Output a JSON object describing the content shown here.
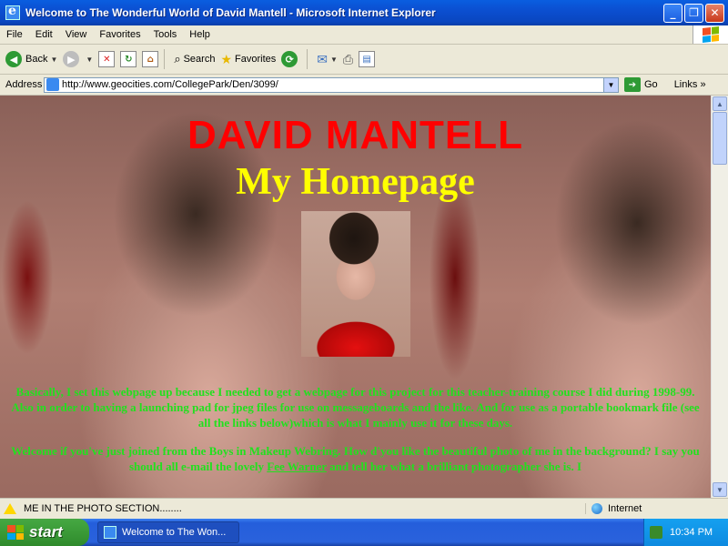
{
  "window": {
    "title": "Welcome to The Wonderful World of David Mantell - Microsoft Internet Explorer",
    "buttons": {
      "minimize": "_",
      "maximize": "❐",
      "close": "✕"
    }
  },
  "menu": [
    "File",
    "Edit",
    "View",
    "Favorites",
    "Tools",
    "Help"
  ],
  "toolbar": {
    "back": "Back",
    "search": "Search",
    "favorites": "Favorites"
  },
  "address": {
    "label": "Address",
    "url": "http://www.geocities.com/CollegePark/Den/3099/",
    "go": "Go",
    "links": "Links"
  },
  "page": {
    "name": "DAVID MANTELL",
    "subtitle": "My Homepage",
    "para1": "Basically, I set this webpage up because I needed to get a webpage for this project for this teacher-training course I did during 1998-99. Also in order to having a launching pad for jpeg files for use on messageboards and the like. And for use as a portable bookmark file (see all the links below)which is what I mainly use it for these days.",
    "para2_a": "Welcome if you've just joined from the Boys in Makeup Webring. How d'you like the beautiful photo of me in the background? I say you should all e-mail the lovely ",
    "para2_link": "Fee Warner",
    "para2_b": " and tell her what a brilliant photographer she is. I"
  },
  "status": {
    "text": "ME IN THE PHOTO SECTION........",
    "zone": "Internet"
  },
  "taskbar": {
    "start": "start",
    "task": "Welcome to The Won...",
    "time": "10:34 PM"
  },
  "colors": {
    "heading_red": "#ff0000",
    "subtitle_yellow": "#ffff00",
    "body_green": "#22e01e",
    "xp_blue": "#0a5ee0"
  }
}
